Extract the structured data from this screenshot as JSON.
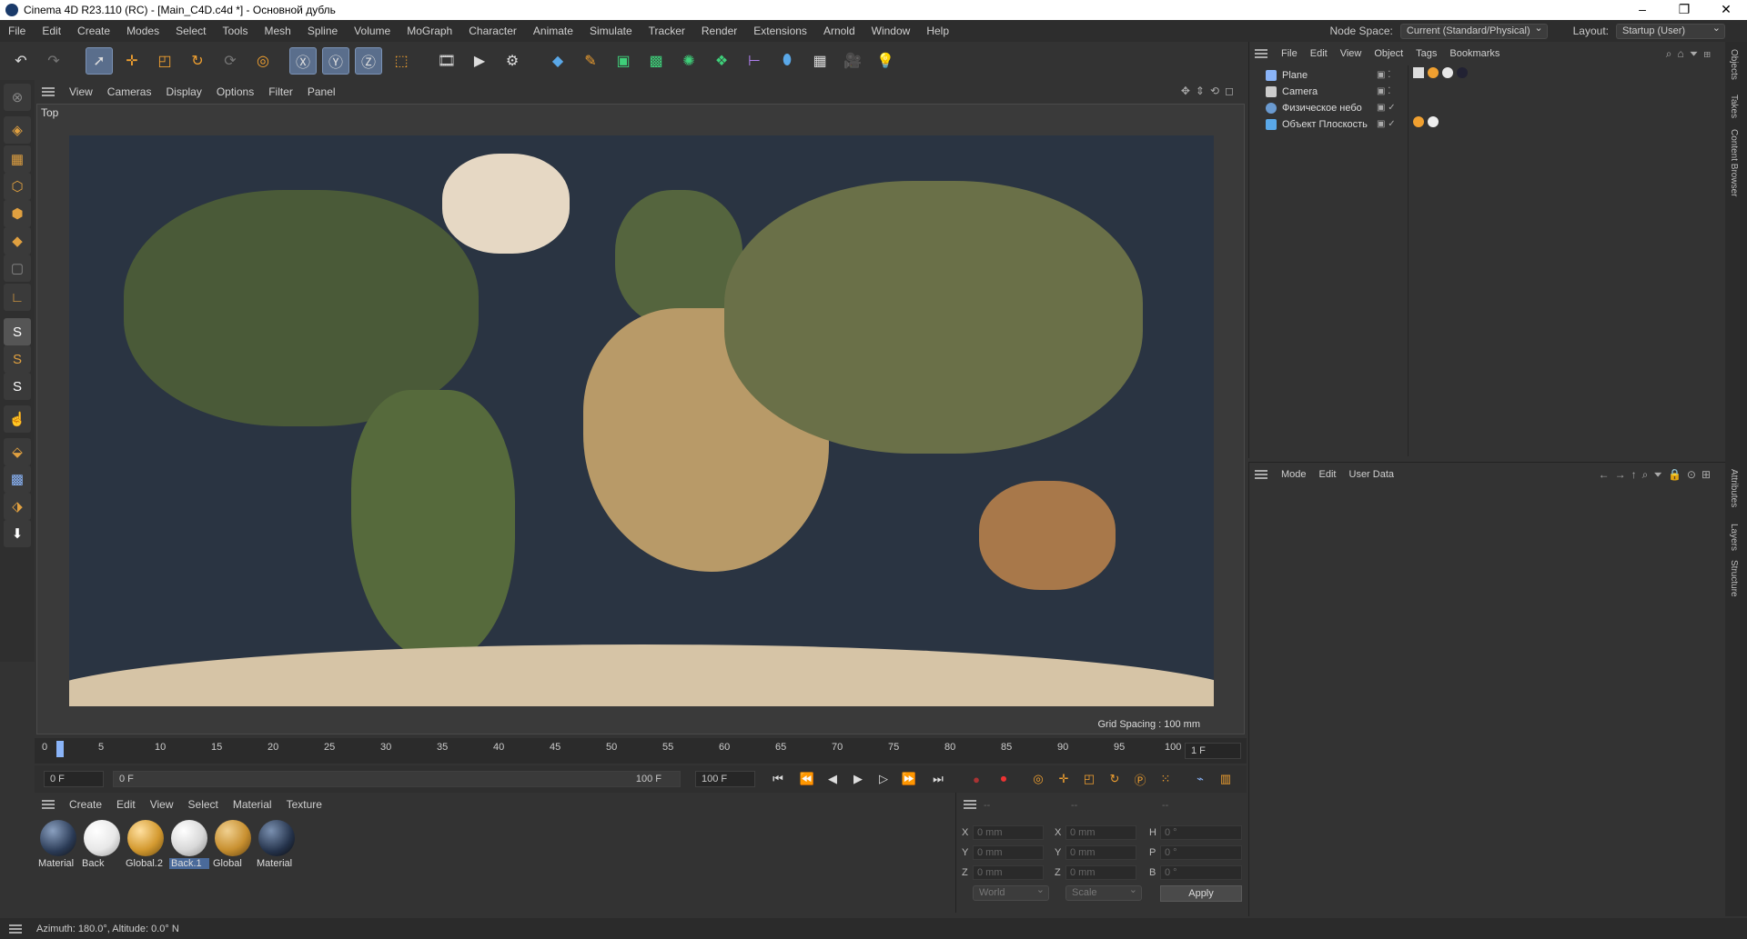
{
  "title": "Cinema 4D R23.110 (RC) - [Main_C4D.c4d *] - Основной дубль",
  "window_controls": [
    "–",
    "❐",
    "✕"
  ],
  "menu": [
    "File",
    "Edit",
    "Create",
    "Modes",
    "Select",
    "Tools",
    "Mesh",
    "Spline",
    "Volume",
    "MoGraph",
    "Character",
    "Animate",
    "Simulate",
    "Tracker",
    "Render",
    "Extensions",
    "Arnold",
    "Window",
    "Help"
  ],
  "node_space": {
    "label": "Node Space:",
    "value": "Current (Standard/Physical)"
  },
  "layout": {
    "label": "Layout:",
    "value": "Startup (User)"
  },
  "viewport": {
    "menu": [
      "View",
      "Cameras",
      "Display",
      "Options",
      "Filter",
      "Panel"
    ],
    "label": "Top",
    "grid_spacing": "Grid Spacing : 100 mm"
  },
  "timeline": {
    "ticks": [
      "0",
      "5",
      "10",
      "15",
      "20",
      "25",
      "30",
      "35",
      "40",
      "45",
      "50",
      "55",
      "60",
      "65",
      "70",
      "75",
      "80",
      "85",
      "90",
      "95",
      "100"
    ],
    "current": "1 F",
    "start": "0 F",
    "range_start": "0 F",
    "range_end": "100 F",
    "end": "100 F"
  },
  "material_menu": [
    "Create",
    "Edit",
    "View",
    "Select",
    "Material",
    "Texture"
  ],
  "materials": [
    {
      "name": "Material",
      "color": "#2a3a55"
    },
    {
      "name": "Back",
      "color": "#e8e8e8"
    },
    {
      "name": "Global.2",
      "color": "#d49a30"
    },
    {
      "name": "Back.1",
      "color": "#d8d8d8",
      "selected": true
    },
    {
      "name": "Global",
      "color": "#c89030"
    },
    {
      "name": "Material",
      "color": "#24324a"
    }
  ],
  "coords": {
    "headers": [
      "--",
      "--",
      "--"
    ],
    "rows": [
      {
        "a": "X",
        "av": "0 mm",
        "b": "X",
        "bv": "0 mm",
        "c": "H",
        "cv": "0 °"
      },
      {
        "a": "Y",
        "av": "0 mm",
        "b": "Y",
        "bv": "0 mm",
        "c": "P",
        "cv": "0 °"
      },
      {
        "a": "Z",
        "av": "0 mm",
        "b": "Z",
        "bv": "0 mm",
        "c": "B",
        "cv": "0 °"
      }
    ],
    "mode1": "World",
    "mode2": "Scale",
    "apply": "Apply"
  },
  "status": "Azimuth: 180.0°, Altitude: 0.0°  N",
  "objects_menu": [
    "File",
    "Edit",
    "View",
    "Object",
    "Tags",
    "Bookmarks"
  ],
  "objects": [
    {
      "name": "Plane",
      "color": "#8ab4f8"
    },
    {
      "name": "Camera",
      "color": "#cccccc"
    },
    {
      "name": "Физическое небо",
      "color": "#6a9ad0"
    },
    {
      "name": "Объект Плоскость",
      "color": "#5aa8e8"
    }
  ],
  "attributes_menu": [
    "Mode",
    "Edit",
    "User Data"
  ],
  "side_tabs": [
    "Objects",
    "Takes",
    "Content Browser",
    "Attributes",
    "Layers",
    "Structure"
  ],
  "colors": {
    "accent": "#f0a030",
    "selection": "#5a6e8c",
    "ocean": "#2a3442"
  }
}
